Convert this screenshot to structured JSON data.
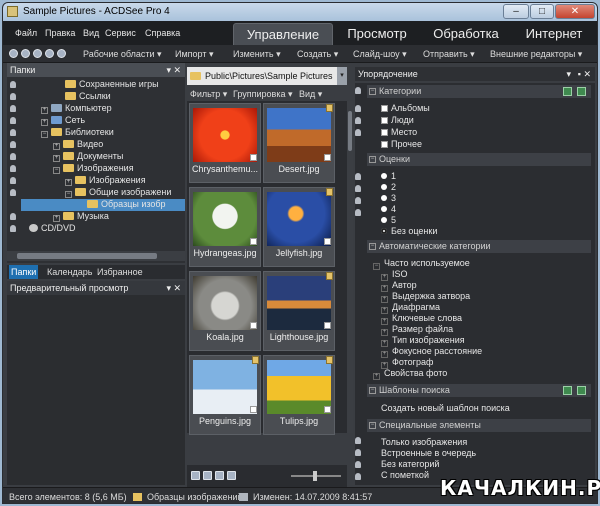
{
  "window": {
    "title": "Sample Pictures - ACDSee Pro 4",
    "minimize": "–",
    "maximize": "□",
    "close": "✕"
  },
  "menu": [
    "Файл",
    "Правка",
    "Вид",
    "Сервис",
    "Справка"
  ],
  "mode_tabs": [
    "Управление",
    "Просмотр",
    "Обработка",
    "Интернет"
  ],
  "toolbar": [
    "Рабочие области ▾",
    "Импорт ▾",
    "Изменить ▾",
    "Создать ▾",
    "Слайд-шоу ▾",
    "Отправить ▾",
    "Внешние редакторы ▾"
  ],
  "folders_panel": {
    "title": "Папки",
    "tree": [
      "Сохраненные игры",
      "Ссылки",
      "Компьютер",
      "Сеть",
      "Библиотеки",
      "Видео",
      "Документы",
      "Изображения",
      "Изображения",
      "Общие изображени",
      "Образцы изобр",
      "Музыка",
      "CD/DVD"
    ],
    "tabs": [
      "Папки",
      "Календарь",
      "Избранное"
    ]
  },
  "preview_panel": {
    "title": "Предварительный просмотр"
  },
  "path": "Public\\Pictures\\Sample Pictures",
  "filterbar": [
    "Фильтр ▾",
    "Группировка ▾",
    "Вид ▾"
  ],
  "thumbnails": [
    "Chrysanthemu...",
    "Desert.jpg",
    "Hydrangeas.jpg",
    "Jellyfish.jpg",
    "Koala.jpg",
    "Lighthouse.jpg",
    "Penguins.jpg",
    "Tulips.jpg"
  ],
  "organize": {
    "title": "Упорядочение",
    "sections": {
      "categories": {
        "title": "Категории",
        "items": [
          "Альбомы",
          "Люди",
          "Место",
          "Прочее"
        ]
      },
      "ratings": {
        "title": "Оценки",
        "items": [
          "1",
          "2",
          "3",
          "4",
          "5",
          "Без оценки"
        ]
      },
      "auto": {
        "title": "Автоматические категории",
        "group": "Часто используемое",
        "items": [
          "ISO",
          "Автор",
          "Выдержка затвора",
          "Диафрагма",
          "Ключевые слова",
          "Размер файла",
          "Тип изображения",
          "Фокусное расстояние",
          "Фотограф"
        ],
        "extra": "Свойства фото"
      },
      "search": {
        "title": "Шаблоны поиска",
        "create": "Создать новый шаблон поиска"
      },
      "special": {
        "title": "Специальные элементы",
        "items": [
          "Только изображения",
          "Встроенные в очередь",
          "Без категорий",
          "С пометкой"
        ]
      }
    }
  },
  "status": {
    "count": "Всего элементов: 8  (5,6 МБ)",
    "folder": "Образцы изображений",
    "modified": "Изменен: 14.07.2009 8:41:57"
  },
  "watermark": "КАЧАЛКИН.РУ",
  "colors": {
    "accent": "#1e6fb0",
    "folder": "#e7c260"
  }
}
